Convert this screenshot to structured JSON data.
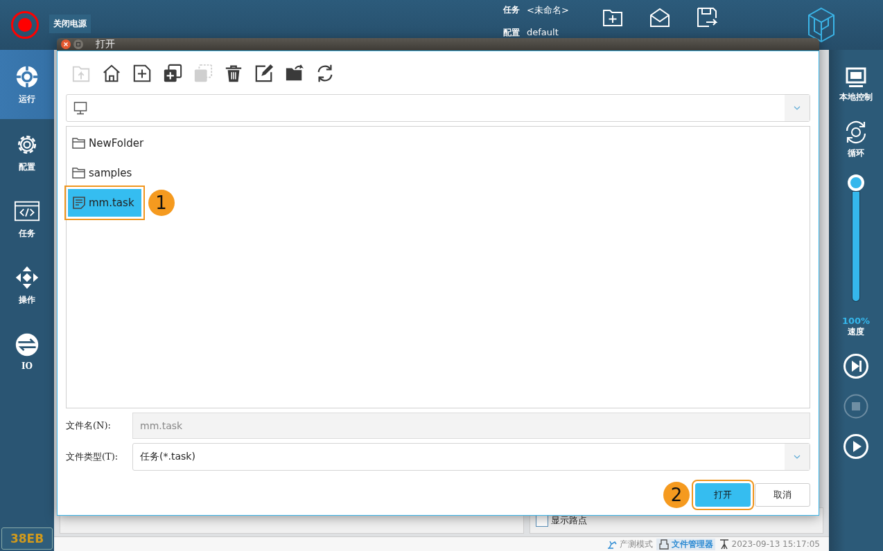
{
  "top_bar": {
    "power_label": "关闭电源",
    "task_label": "任务",
    "task_value": "<未命名>",
    "config_label": "配置",
    "config_value": "default",
    "actions": [
      {
        "kind": "new"
      },
      {
        "kind": "open"
      },
      {
        "kind": "save"
      }
    ]
  },
  "left_nav": [
    {
      "label": "运行",
      "kind": "run",
      "selected": true
    },
    {
      "label": "配置",
      "kind": "config",
      "selected": false
    },
    {
      "label": "任务",
      "kind": "task",
      "selected": false
    },
    {
      "label": "操作",
      "kind": "move",
      "selected": false
    },
    {
      "label": "IO",
      "kind": "io",
      "selected": false
    }
  ],
  "device_badge": "38EB",
  "right_panel": {
    "local_label": "本地控制",
    "loop_label": "循环",
    "speed": {
      "level": 1,
      "reading": "100%",
      "label": "速度"
    },
    "controls": [
      {
        "kind": "step",
        "disabled": false
      },
      {
        "kind": "stop",
        "disabled": true
      },
      {
        "kind": "play",
        "disabled": false
      }
    ]
  },
  "show_waypoints": {
    "label": "显示路点",
    "checked": false
  },
  "status_bar": {
    "mode": "产测模式",
    "file_manager": "文件管理器",
    "datetime": "2023-09-13 15:17:05"
  },
  "dialog": {
    "title": "打开",
    "toolbar": [
      {
        "kind": "up",
        "disabled": true
      },
      {
        "kind": "home",
        "disabled": false
      },
      {
        "kind": "new-file",
        "disabled": false
      },
      {
        "kind": "copy",
        "disabled": false
      },
      {
        "kind": "paste",
        "disabled": true
      },
      {
        "kind": "delete",
        "disabled": false
      },
      {
        "kind": "rename",
        "disabled": false
      },
      {
        "kind": "open-folder",
        "disabled": false
      },
      {
        "kind": "refresh",
        "disabled": false
      }
    ],
    "files": [
      {
        "name": "NewFolder",
        "kind": "folder",
        "selected": false
      },
      {
        "name": "samples",
        "kind": "folder",
        "selected": false
      },
      {
        "name": "mm.task",
        "kind": "file",
        "selected": true,
        "callout": "1"
      }
    ],
    "filename": {
      "label": "文件名(N):",
      "value": "mm.task"
    },
    "filetype": {
      "label": "文件类型(T):",
      "value": "任务(*.task)"
    },
    "buttons": [
      {
        "label": "打开",
        "primary": true,
        "callout": "2"
      },
      {
        "label": "取消",
        "primary": false
      }
    ]
  }
}
